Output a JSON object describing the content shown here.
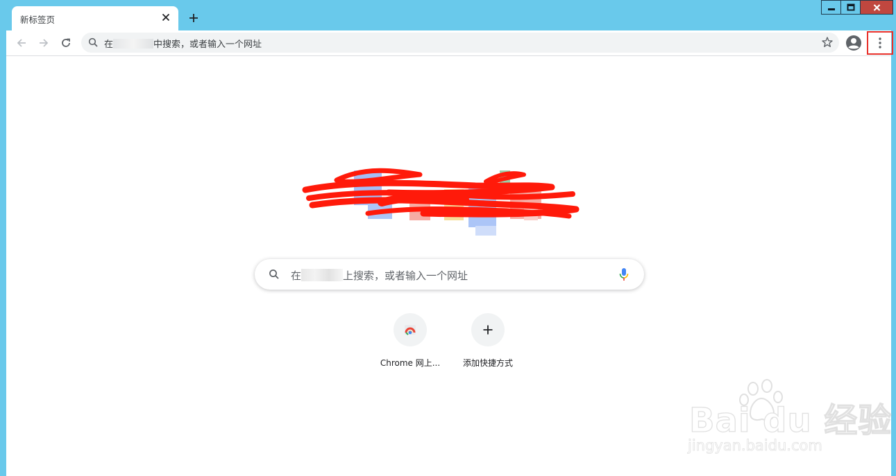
{
  "window": {
    "title_tab": "新标签页",
    "controls": {
      "minimize": "minimize",
      "maximize": "maximize",
      "close": "x"
    }
  },
  "toolbar": {
    "omnibox_prefix": "在",
    "omnibox_suffix": "中搜索，或者输入一个网址"
  },
  "ntp": {
    "search_prefix": "在",
    "search_suffix": "上搜索，或者输入一个网址",
    "shortcuts": [
      {
        "label": "Chrome 网上...",
        "icon": "chrome-webstore-icon"
      },
      {
        "label": "添加快捷方式",
        "icon": "plus-icon"
      }
    ]
  },
  "watermark": {
    "brand": "Bai du 经验",
    "domain": "jingyan.baidu.com"
  },
  "colors": {
    "frame": "#69c9eb",
    "close": "#c0473f",
    "highlight": "#e8302a",
    "scribble": "#ff1a0a"
  }
}
